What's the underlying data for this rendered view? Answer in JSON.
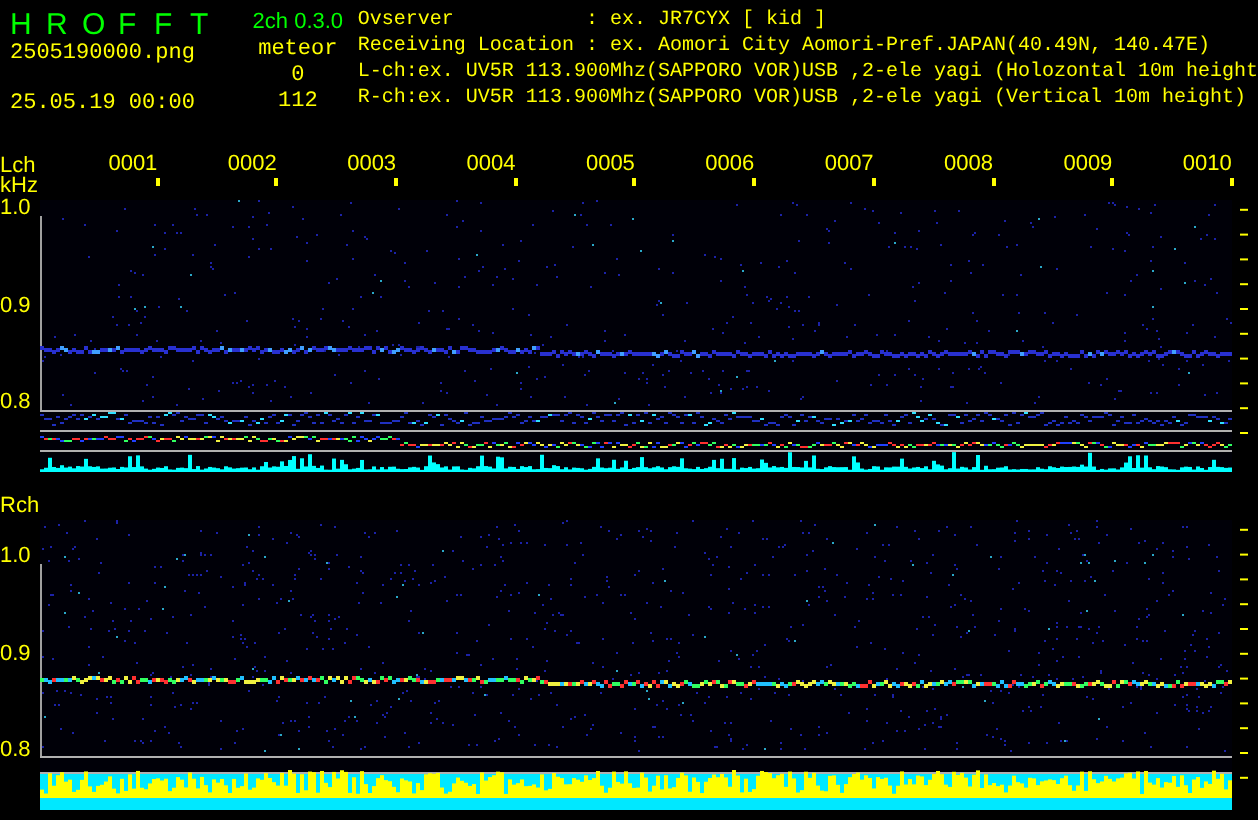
{
  "header": {
    "logo_letters": [
      "H",
      "R",
      "O",
      "F",
      "F",
      "T"
    ],
    "version": "2ch 0.3.0",
    "filename": "2505190000.png",
    "datetime": "25.05.19 00:00",
    "meteor_label": "meteor",
    "meteor_counts": [
      "0",
      "112"
    ],
    "info_lines": [
      "Ovserver           : ex. JR7CYX [ kid ]",
      "Receiving Location : ex. Aomori City Aomori-Pref.JAPAN(40.49N, 140.47E)",
      "L-ch:ex. UV5R 113.900Mhz(SAPPORO VOR)USB ,2-ele yagi (Holozontal 10m height",
      "R-ch:ex. UV5R 113.900Mhz(SAPPORO VOR)USB ,2-ele yagi (Vertical 10m height)"
    ]
  },
  "time_labels": [
    "0001",
    "0002",
    "0003",
    "0004",
    "0005",
    "0006",
    "0007",
    "0008",
    "0009",
    "0010"
  ],
  "channels": [
    {
      "label": "Lch",
      "unit": "kHz",
      "ticks": [
        "1.0",
        "0.9",
        "0.8"
      ]
    },
    {
      "label": "Rch",
      "ticks": [
        "1.0",
        "0.9",
        "0.8"
      ]
    }
  ]
}
